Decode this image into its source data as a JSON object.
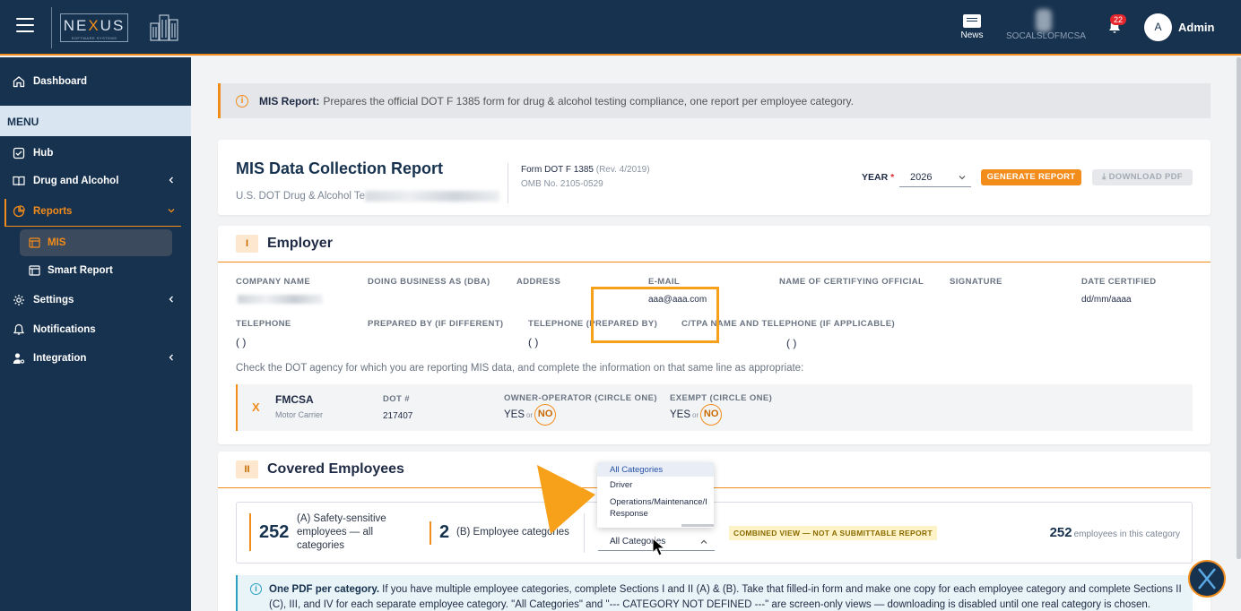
{
  "topbar": {
    "logo_text_a": "NE",
    "logo_text_x": "X",
    "logo_text_b": "US",
    "logo_sub": "SOFTWARE SYSTEMS",
    "news_label": "News",
    "company_label": "SOCALSLOFMCSA",
    "notification_count": "22",
    "avatar_initial": "A",
    "user_name": "Admin"
  },
  "sidebar": {
    "dashboard": "Dashboard",
    "menu_header": "MENU",
    "hub": "Hub",
    "drug_alcohol": "Drug and Alcohol",
    "reports": "Reports",
    "mis": "MIS",
    "smart_report": "Smart Report",
    "settings": "Settings",
    "notifications": "Notifications",
    "integration": "Integration"
  },
  "banner": {
    "title": "MIS Report:",
    "text": "Prepares the official DOT F 1385 form for drug & alcohol testing compliance, one report per employee category."
  },
  "report": {
    "title": "MIS Data Collection Report",
    "subtitle": "U.S. DOT Drug & Alcohol Te",
    "form_label": "Form DOT F 1385",
    "form_rev": "(Rev. 4/2019)",
    "omb": "OMB No. 2105-0529",
    "year_label": "YEAR",
    "year_required": "*",
    "year_value": "2026",
    "generate_label": "GENERATE REPORT",
    "download_label": "DOWNLOAD PDF"
  },
  "employer": {
    "section_num": "I",
    "section_title": "Employer",
    "company_name_label": "COMPANY NAME",
    "dba_label": "DOING BUSINESS AS (DBA)",
    "address_label": "ADDRESS",
    "email_label": "E-MAIL",
    "email_value": "aaa@aaa.com",
    "certifying_label": "NAME OF CERTIFYING OFFICIAL",
    "signature_label": "SIGNATURE",
    "date_label": "DATE CERTIFIED",
    "date_value": "dd/mm/aaaa",
    "telephone_label": "TELEPHONE",
    "prepared_by_label": "PREPARED BY (IF DIFFERENT)",
    "tel_prepared_label": "TELEPHONE (PREPARED BY)",
    "ctpa_label": "C/TPA NAME AND TELEPHONE (IF APPLICABLE)",
    "paren_empty": "(        )",
    "check_text": "Check the DOT agency for which you are reporting MIS data, and complete the information on that same line as appropriate:",
    "agency_mark": "X",
    "agency_name": "FMCSA",
    "agency_sub": "Motor Carrier",
    "dot_label": "DOT #",
    "dot_value": "217407",
    "owner_label": "OWNER-OPERATOR (CIRCLE ONE)",
    "exempt_label": "EXEMPT (CIRCLE ONE)",
    "yes": "YES",
    "or": "or",
    "no": "NO"
  },
  "covered": {
    "section_num": "II",
    "section_title": "Covered Employees",
    "stat_a_value": "252",
    "stat_a_label": "(A) Safety-sensitive employees — all categories",
    "stat_b_value": "2",
    "stat_b_label": "(B) Employee categories",
    "category_selected": "All Categories",
    "combined_badge": "COMBINED VIEW — NOT A SUBMITTABLE REPORT",
    "count_value": "252",
    "count_label": "employees in this category",
    "dropdown_options": [
      "All Categories",
      "Driver",
      "Operations/Maintenance/I",
      "Response"
    ],
    "note_title": "One PDF per category.",
    "note_text": "If you have multiple employee categories, complete Sections I and II (A) & (B). Take that filled-in form and make one copy for each employee category and complete Sections II (C), III, and IV for each separate employee category. \"All Categories\" and \"--- CATEGORY NOT DEFINED ---\" are screen-only views — downloading is disabled until one real category is chosen."
  },
  "colors": {
    "navy": "#17324f",
    "accent": "#f28c1a",
    "highlight": "#f7a11a",
    "info": "#2a9fc2"
  }
}
